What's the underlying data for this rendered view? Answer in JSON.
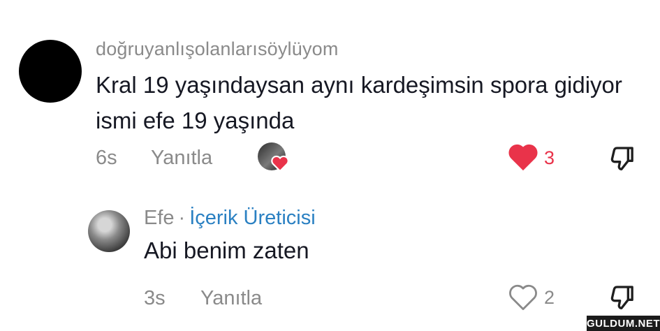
{
  "comment": {
    "username": "doğruyanlışolanlarısöylüyom",
    "text": "Kral 19 yaşındaysan aynı kardeşimsin spora gidiyor ismi efe 19 yaşında",
    "time": "6s",
    "reply_label": "Yanıtla",
    "like_count": "3",
    "liked": true,
    "like_color": "#e9334a",
    "icons": [
      "heart-filled-icon",
      "dislike-icon",
      "creator-liked-heart-icon"
    ]
  },
  "reply": {
    "username": "Efe",
    "separator": "·",
    "badge": "İçerik Üreticisi",
    "badge_color": "#2a80c2",
    "text": "Abi benim zaten",
    "time": "3s",
    "reply_label": "Yanıtla",
    "like_count": "2",
    "liked": false,
    "icons": [
      "heart-outline-icon",
      "dislike-icon"
    ]
  },
  "watermark": "GULDUM.NET"
}
